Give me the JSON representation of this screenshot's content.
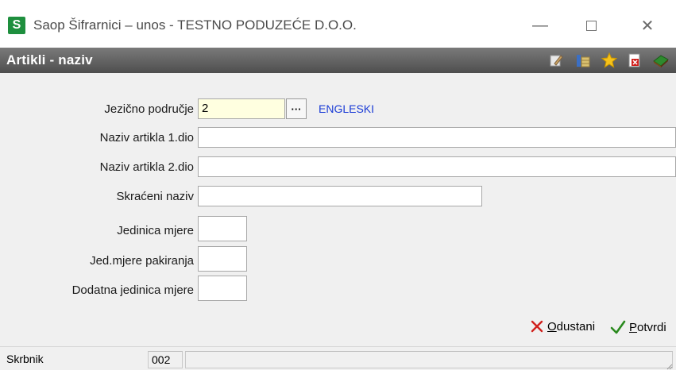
{
  "window": {
    "app_icon_letter": "S",
    "title": "Saop Šifrarnici – unos - TESTNO PODUZEĆE D.O.O.",
    "min_symbol": "—",
    "close_symbol": "✕"
  },
  "header": {
    "title": "Artikli - naziv",
    "toolbar_icons": [
      "edit-icon",
      "columns-icon",
      "star-icon",
      "pdf-icon",
      "book-icon"
    ]
  },
  "form": {
    "fields": [
      {
        "label": "Jezično područje",
        "value": "2",
        "button": "···",
        "lookup_text": "ENGLESKI"
      },
      {
        "label": "Naziv artikla 1.dio",
        "value": ""
      },
      {
        "label": "Naziv artikla 2.dio",
        "value": ""
      },
      {
        "label": "Skraćeni naziv",
        "value": ""
      },
      {
        "label": "Jedinica mjere",
        "value": ""
      },
      {
        "label": "Jed.mjere pakiranja",
        "value": ""
      },
      {
        "label": "Dodatna jedinica mjere",
        "value": ""
      }
    ]
  },
  "buttons": {
    "cancel_mnemonic": "O",
    "cancel_rest": "dustani",
    "confirm_mnemonic": "P",
    "confirm_rest": "otvrdi"
  },
  "status": {
    "left": "Skrbnik",
    "code": "002"
  },
  "colors": {
    "header_band": "#5a5a5a",
    "lookup_text": "#1a3bd6",
    "cancel_x": "#d0201c",
    "confirm_check": "#2a8a1e"
  }
}
